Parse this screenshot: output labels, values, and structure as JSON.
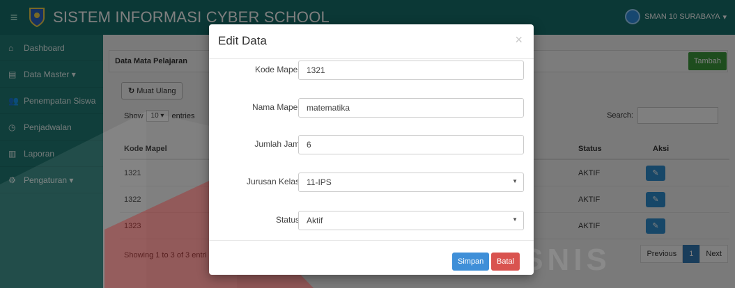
{
  "navbar": {
    "title": "SISTEM INFORMASI CYBER SCHOOL",
    "school_name": "SMAN 10 SURABAYA",
    "school_caret": "▾",
    "menu_icon": "hamburger-icon"
  },
  "sidebar": {
    "items": [
      {
        "label": "Dashboard",
        "icon": "home-icon"
      },
      {
        "label": "Data Master ▾",
        "icon": "book-icon"
      },
      {
        "label": "Penempatan Siswa",
        "icon": "users-icon"
      },
      {
        "label": "Penjadwalan",
        "icon": "clock-icon"
      },
      {
        "label": "Laporan",
        "icon": "report-icon"
      },
      {
        "label": "Pengaturan ▾",
        "icon": "gear-icon"
      }
    ]
  },
  "main": {
    "panel_title": "Data Mata Pelajaran",
    "add_button": "Tambah",
    "reload_button": "Muat Ulang",
    "show_label": "Show",
    "entries_value": "10",
    "entries_label": "entries",
    "search_label": "Search:",
    "columns": [
      "Kode Mapel",
      "Status",
      "Aksi"
    ],
    "rows": [
      {
        "kode": "1321",
        "status": "AKTIF"
      },
      {
        "kode": "1322",
        "status": "AKTIF"
      },
      {
        "kode": "1323",
        "status": "AKTIF"
      }
    ],
    "info": "Showing 1 to 3 of 3 entri",
    "pager": {
      "previous": "Previous",
      "page": "1",
      "next": "Next"
    }
  },
  "modal": {
    "title": "Edit Data",
    "close": "×",
    "fields": [
      {
        "label": "Kode Mapel",
        "value": "1321"
      },
      {
        "label": "Nama Mapel",
        "value": "matematika"
      },
      {
        "label": "Jumlah Jam",
        "value": "6"
      },
      {
        "label": "Jurusan Kelas",
        "value": "11-IPS"
      },
      {
        "label": "Status",
        "value": "Aktif"
      }
    ],
    "save_button": "Simpan",
    "cancel_button": "Batal"
  },
  "watermark": {
    "text": "INSTITUT BISNIS"
  },
  "colors": {
    "navbar": "#16706c",
    "sidebar": "#207c76",
    "primary": "#3f8fd8",
    "danger": "#d9534f",
    "success": "#3c9a3c"
  }
}
